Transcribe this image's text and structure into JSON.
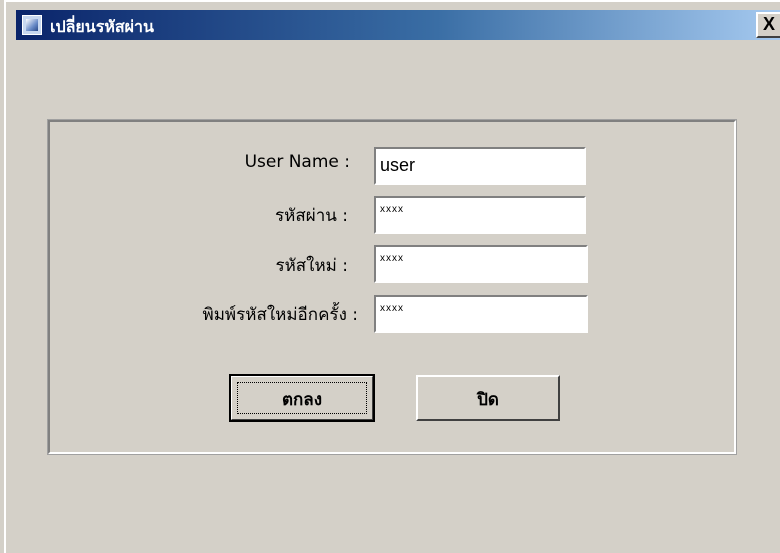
{
  "window": {
    "title": "เปลี่ยนรหัสผ่าน",
    "close_glyph": "X"
  },
  "form": {
    "username_label": "User Name :",
    "username_value": "user",
    "password_label": "รหัสผ่าน :",
    "password_value": "xxxx",
    "new_password_label": "รหัสใหม่ :",
    "new_password_value": "xxxx",
    "confirm_password_label": "พิมพ์รหัสใหม่อีกครั้ง :",
    "confirm_password_value": "xxxx"
  },
  "buttons": {
    "ok_label": "ตกลง",
    "close_label": "ปิด"
  },
  "colors": {
    "titlebar_start": "#0a246a",
    "titlebar_end": "#a6caf0",
    "dialog_bg": "#d4d0c8"
  },
  "icons": {
    "title_icon": "app-window-icon",
    "close_icon": "close-icon"
  }
}
